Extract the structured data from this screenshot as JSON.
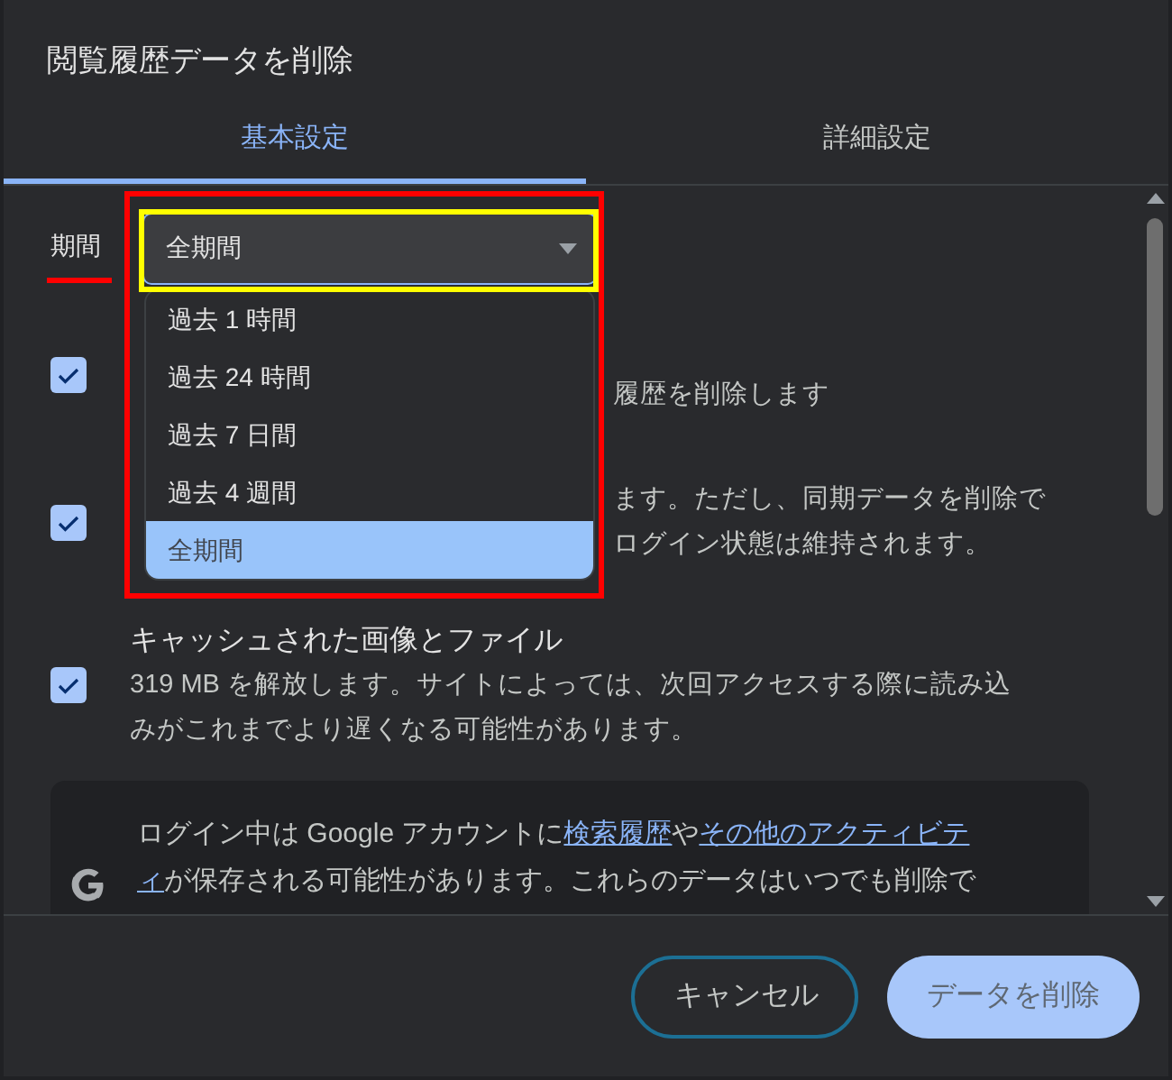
{
  "dialog": {
    "title": "閲覧履歴データを削除"
  },
  "tabs": [
    {
      "label": "基本設定",
      "selected": true
    },
    {
      "label": "詳細設定",
      "selected": false
    }
  ],
  "time_range": {
    "label": "期間",
    "value": "全期間",
    "expanded": true,
    "options": [
      {
        "label": "過去 1 時間",
        "selected": false
      },
      {
        "label": "過去 24 時間",
        "selected": false
      },
      {
        "label": "過去 7 日間",
        "selected": false
      },
      {
        "label": "過去 4 週間",
        "selected": false
      },
      {
        "label": "全期間",
        "selected": true
      }
    ]
  },
  "items": [
    {
      "checked": true,
      "visible_lines": [
        "履歴を削除します"
      ]
    },
    {
      "checked": true,
      "visible_lines": [
        "ます。ただし、同期データを削除で",
        "ログイン状態は維持されます。"
      ]
    },
    {
      "checked": true,
      "title": "キャッシュされた画像とファイル",
      "description": "319 MB を解放します。サイトによっては、次回アクセスする際に読み込みがこれまでより遅くなる可能性があります。"
    }
  ],
  "notice": {
    "lines": [
      [
        {
          "text": "ログイン中は Google アカウントに"
        },
        {
          "text": "検索履歴",
          "kind": "link"
        },
        {
          "text": "や"
        },
        {
          "text": "その他のアクティビテ",
          "kind": "link"
        }
      ],
      [
        {
          "text": "ィ",
          "kind": "link"
        },
        {
          "text": "が保存される可能性があります。これらのデータはいつでも削除で"
        }
      ]
    ]
  },
  "buttons": [
    {
      "label": "キャンセル",
      "kind": "outline"
    },
    {
      "label": "データを削除",
      "kind": "filled"
    }
  ]
}
